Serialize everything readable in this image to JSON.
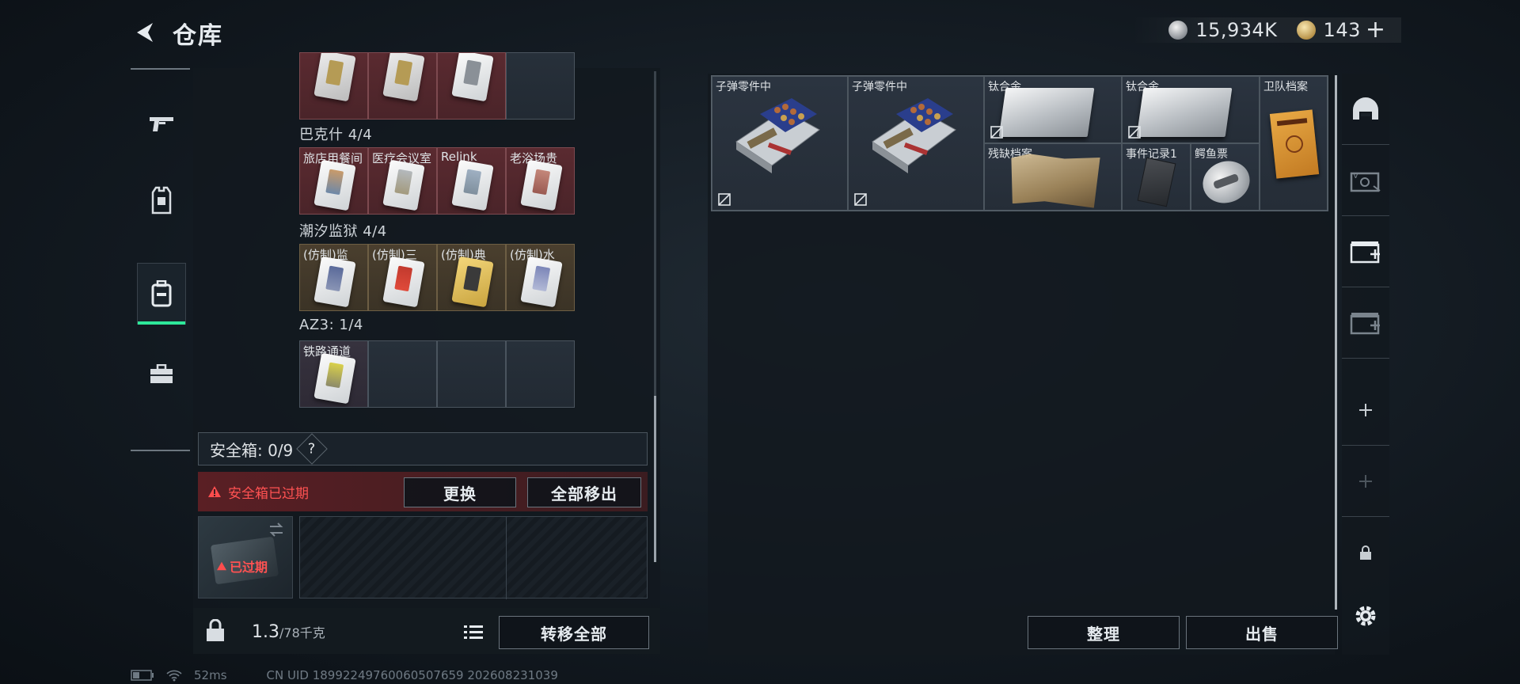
{
  "header": {
    "title": "仓库",
    "currency": [
      {
        "icon": "silver-coin-icon",
        "value": "15,934K"
      },
      {
        "icon": "gold-coin-icon",
        "value": "143"
      }
    ],
    "plus_label": "+"
  },
  "left_nav": [
    {
      "icon": "gun-icon",
      "active": false
    },
    {
      "icon": "vest-icon",
      "active": false
    },
    {
      "icon": "backpack-icon",
      "active": true
    },
    {
      "icon": "toolbox-icon",
      "active": false
    }
  ],
  "key_sections": [
    {
      "title": "",
      "cells": [
        "",
        "",
        "",
        ""
      ]
    },
    {
      "title": "巴克什 4/4",
      "cells": [
        "旅店用餐间",
        "医疗会议室",
        "Relink",
        "老浴场贵"
      ]
    },
    {
      "title": "潮汐监狱 4/4",
      "cells": [
        "(仿制)监",
        "(仿制)三",
        "(仿制)典",
        "(仿制)水"
      ]
    },
    {
      "title": "AZ3: 1/4",
      "cells": [
        "铁路通道",
        "",
        "",
        ""
      ]
    }
  ],
  "safebox": {
    "label": "安全箱: 0/9",
    "help": "?",
    "expired_warning": "安全箱已过期",
    "replace_button": "更换",
    "remove_all_button": "全部移出",
    "slot_status": "已过期"
  },
  "bottom": {
    "weight": "1.3",
    "weight_cap": "/78千克",
    "transfer_all_button": "转移全部"
  },
  "stash": {
    "items": [
      {
        "label": "子弹零件中",
        "type": "ammo"
      },
      {
        "label": "子弹零件中",
        "type": "ammo"
      },
      {
        "label": "钛合金",
        "type": "plate"
      },
      {
        "label": "钛合金",
        "type": "plate"
      },
      {
        "label": "卫队档案",
        "type": "folder"
      },
      {
        "label": "残缺档案",
        "type": "paper"
      },
      {
        "label": "事件记录1",
        "type": "notebook"
      },
      {
        "label": "鳄鱼票",
        "type": "badge"
      }
    ],
    "organize_button": "整理",
    "sell_button": "出售"
  },
  "right_nav": [
    {
      "icon": "helmet-icon"
    },
    {
      "icon": "storage-box-icon"
    },
    {
      "icon": "storage-add-icon"
    },
    {
      "icon": "storage-locked-icon"
    },
    {
      "icon": "plus-icon"
    },
    {
      "icon": "plus-faded-icon"
    },
    {
      "icon": "lock-icon"
    },
    {
      "icon": "settings-icon"
    }
  ],
  "status_bar": {
    "ping": "52ms",
    "uid": "CN UID 18992249760060507659 202608231039"
  }
}
